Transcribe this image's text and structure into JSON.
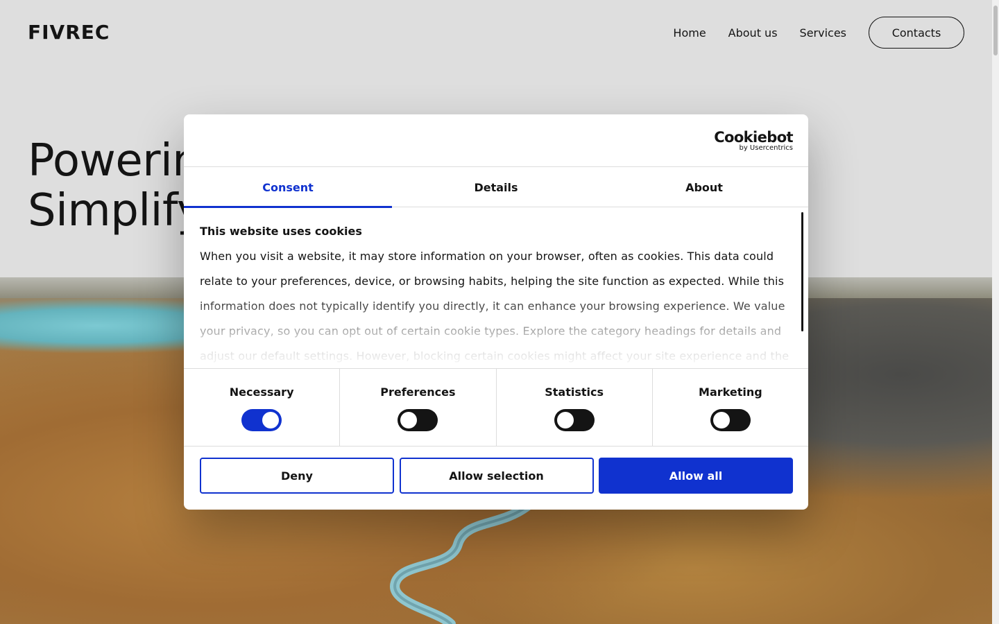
{
  "site": {
    "logo": "FIVREC",
    "nav": {
      "home": "Home",
      "about": "About us",
      "services": "Services",
      "contacts": "Contacts"
    },
    "hero": {
      "line1": "Powerin",
      "line2": "Simplify"
    }
  },
  "dialog": {
    "brand": {
      "name": "Cookiebot",
      "sub": "by Usercentrics"
    },
    "tabs": [
      "Consent",
      "Details",
      "About"
    ],
    "active_tab": "Consent",
    "title": "This website uses cookies",
    "text": "When you visit a website, it may store information on your browser, often as cookies. This data could relate to your preferences, device, or browsing habits, helping the site function as expected. While this information does not typically identify you directly, it can enhance your browsing experience. We value your privacy, so you can opt out of certain cookie types. Explore the category headings for details and adjust our default settings. However, blocking certain cookies might affect your site experience and the",
    "toggles": [
      {
        "label": "Necessary",
        "on": true
      },
      {
        "label": "Preferences",
        "on": false
      },
      {
        "label": "Statistics",
        "on": false
      },
      {
        "label": "Marketing",
        "on": false
      }
    ],
    "buttons": {
      "deny": "Deny",
      "allow_selection": "Allow selection",
      "allow_all": "Allow all"
    }
  },
  "colors": {
    "accent": "#1032cf",
    "background": "#dedede",
    "text": "#141414"
  }
}
